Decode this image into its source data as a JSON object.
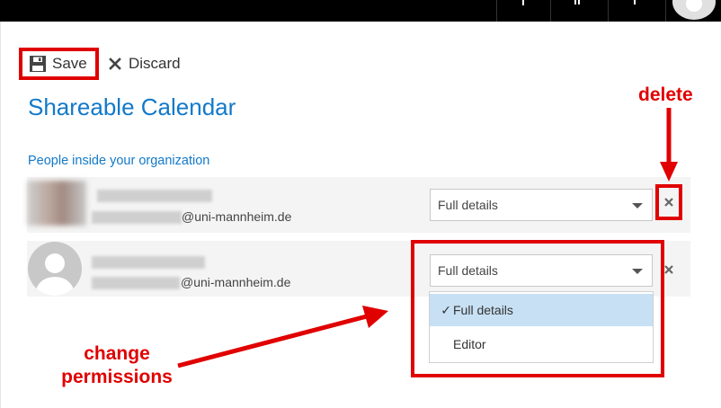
{
  "toolbar": {
    "save_label": "Save",
    "discard_label": "Discard"
  },
  "calendar": {
    "title": "Shareable Calendar",
    "section_label": "People inside your organization"
  },
  "people": [
    {
      "email": "@uni-mannheim.de",
      "permission": "Full details"
    },
    {
      "email": "@uni-mannheim.de",
      "permission": "Full details"
    }
  ],
  "permission_menu": {
    "options": [
      {
        "label": "Full details",
        "selected": true
      },
      {
        "label": "Editor",
        "selected": false
      }
    ]
  },
  "annotations": {
    "delete": "delete",
    "change_permissions": "change\npermissions"
  },
  "colors": {
    "accent": "#1279c9",
    "annotation_red": "#e00000",
    "selected_bg": "#c7e0f4"
  },
  "icons": {
    "save": "floppy-disk-icon",
    "discard": "x-icon",
    "delete": "x-icon",
    "check": "checkmark-icon"
  }
}
